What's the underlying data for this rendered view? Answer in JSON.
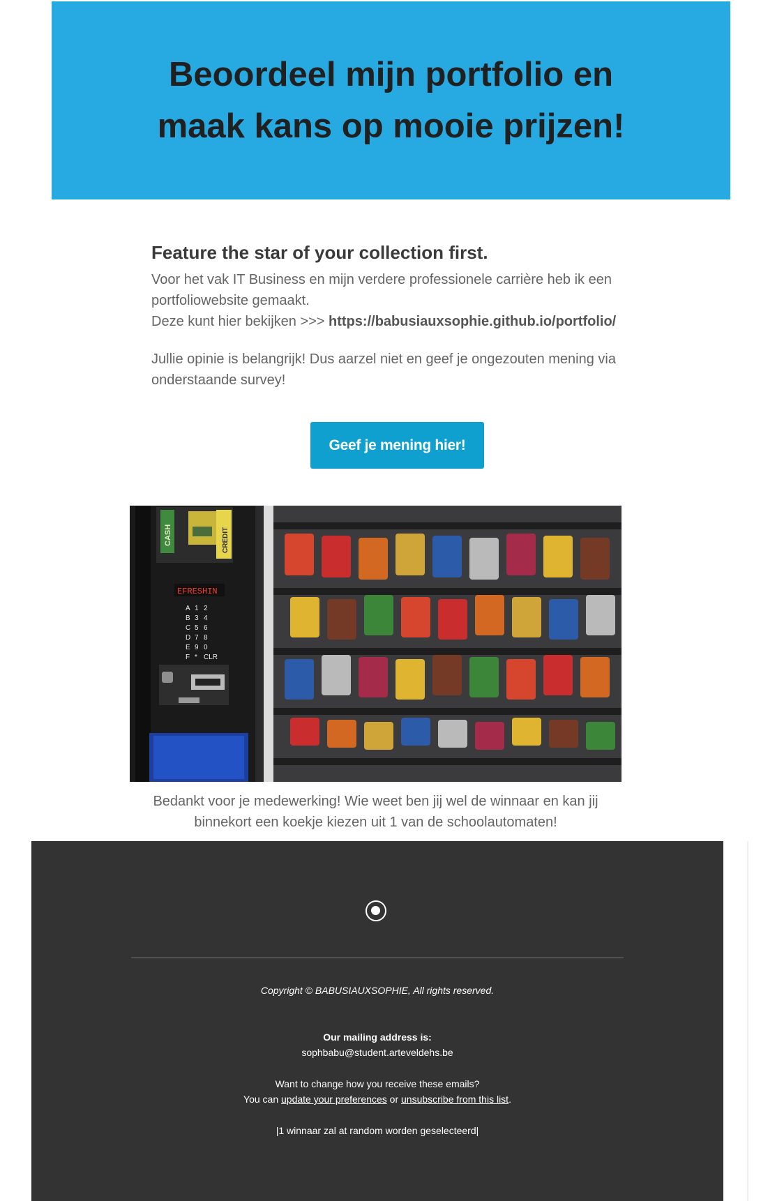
{
  "hero": {
    "title": "Beoordeel mijn portfolio en maak kans op mooie prijzen!",
    "bg_color": "#27aae1"
  },
  "content": {
    "heading": "Feature the star of your collection first.",
    "para1": "Voor het vak IT Business en mijn verdere professionele carrière heb ik een portfoliowebsite gemaakt.",
    "link_prefix": "Deze kunt hier bekijken >>> ",
    "link_url": "https://babusiauxsophie.github.io/portfolio/",
    "para2": "Jullie opinie is belangrijk! Dus aarzel niet en geef je ongezouten mening via onderstaande survey!"
  },
  "cta": {
    "label": "Geef je mening hier!",
    "color": "#0fa0cf"
  },
  "photo": {
    "panel": {
      "cash": "CASH",
      "credit": "CREDIT",
      "display": "EFRESHIN"
    },
    "keypad": [
      "A",
      "1",
      "2",
      "B",
      "3",
      "4",
      "C",
      "5",
      "6",
      "D",
      "7",
      "8",
      "E",
      "9",
      "0",
      "F",
      "*",
      "CLR"
    ]
  },
  "caption": "Bedankt voor je medewerking! Wie weet ben jij wel de winnaar en kan jij binnekort een koekje kiezen uit 1 van de schoolautomaten!",
  "footer": {
    "github_icon": "github-icon",
    "copyright": "Copyright © BABUSIAUXSOPHIE, All rights reserved.",
    "mailing_heading": "Our mailing address is:",
    "mailing_address": "sophbabu@student.arteveldehs.be",
    "change_line": "Want to change how you receive these emails?",
    "you_can": "You can ",
    "update_link": "update your preferences",
    "or": " or ",
    "unsubscribe_link": "unsubscribe from this list",
    "period": ".",
    "note": "|1 winnaar zal at random worden geselecteerd|",
    "bg_color": "#333333"
  }
}
